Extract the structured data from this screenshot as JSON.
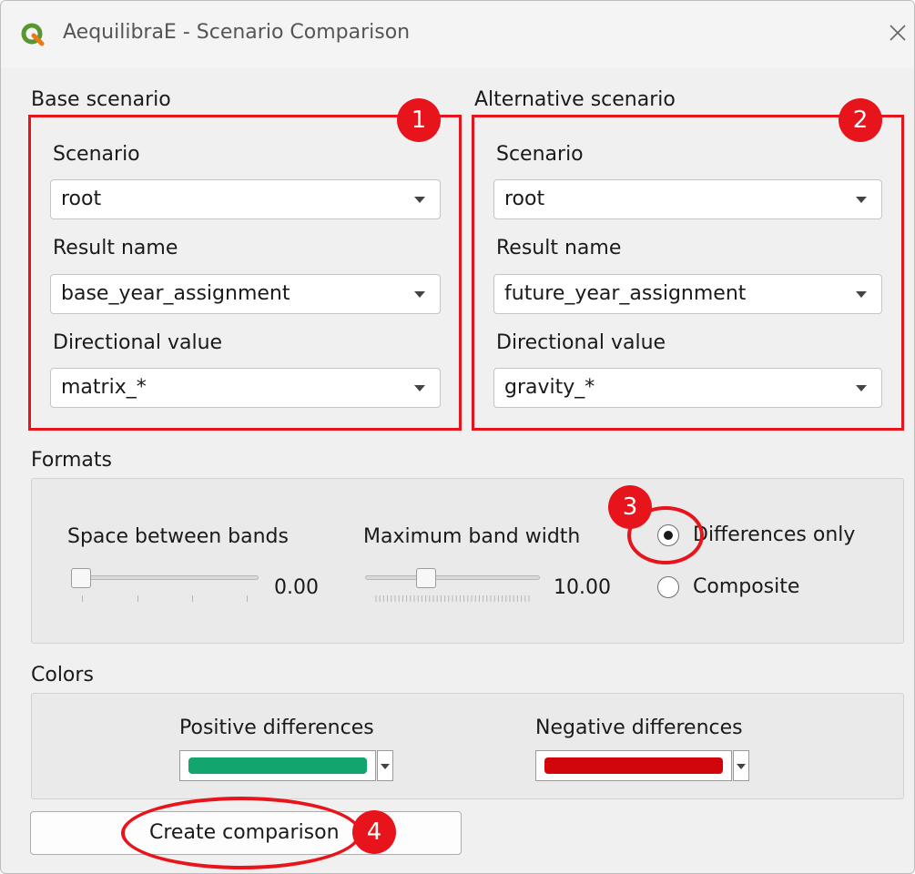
{
  "window": {
    "title": "AequilibraE - Scenario Comparison"
  },
  "base": {
    "heading": "Base scenario",
    "scenario_label": "Scenario",
    "scenario_value": "root",
    "result_label": "Result name",
    "result_value": "base_year_assignment",
    "directional_label": "Directional value",
    "directional_value": "matrix_*",
    "badge": "1"
  },
  "alternative": {
    "heading": "Alternative scenario",
    "scenario_label": "Scenario",
    "scenario_value": "root",
    "result_label": "Result name",
    "result_value": "future_year_assignment",
    "directional_label": "Directional value",
    "directional_value": "gravity_*",
    "badge": "2"
  },
  "formats": {
    "heading": "Formats",
    "space_label": "Space between bands",
    "space_value": "0.00",
    "space_level": 0.0,
    "width_label": "Maximum band width",
    "width_value": "10.00",
    "width_level": 0.33,
    "radio_differences": "Differences only",
    "radio_composite": "Composite",
    "selected": "Differences only",
    "badge": "3"
  },
  "colors": {
    "heading": "Colors",
    "positive_label": "Positive differences",
    "positive_color": "#12a56e",
    "negative_label": "Negative differences",
    "negative_color": "#d0060c"
  },
  "actions": {
    "create_label": "Create comparison",
    "badge": "4"
  },
  "annotation_color": "#e8141b",
  "icons": {
    "app": "qgis-logo-icon",
    "close": "close-icon"
  }
}
